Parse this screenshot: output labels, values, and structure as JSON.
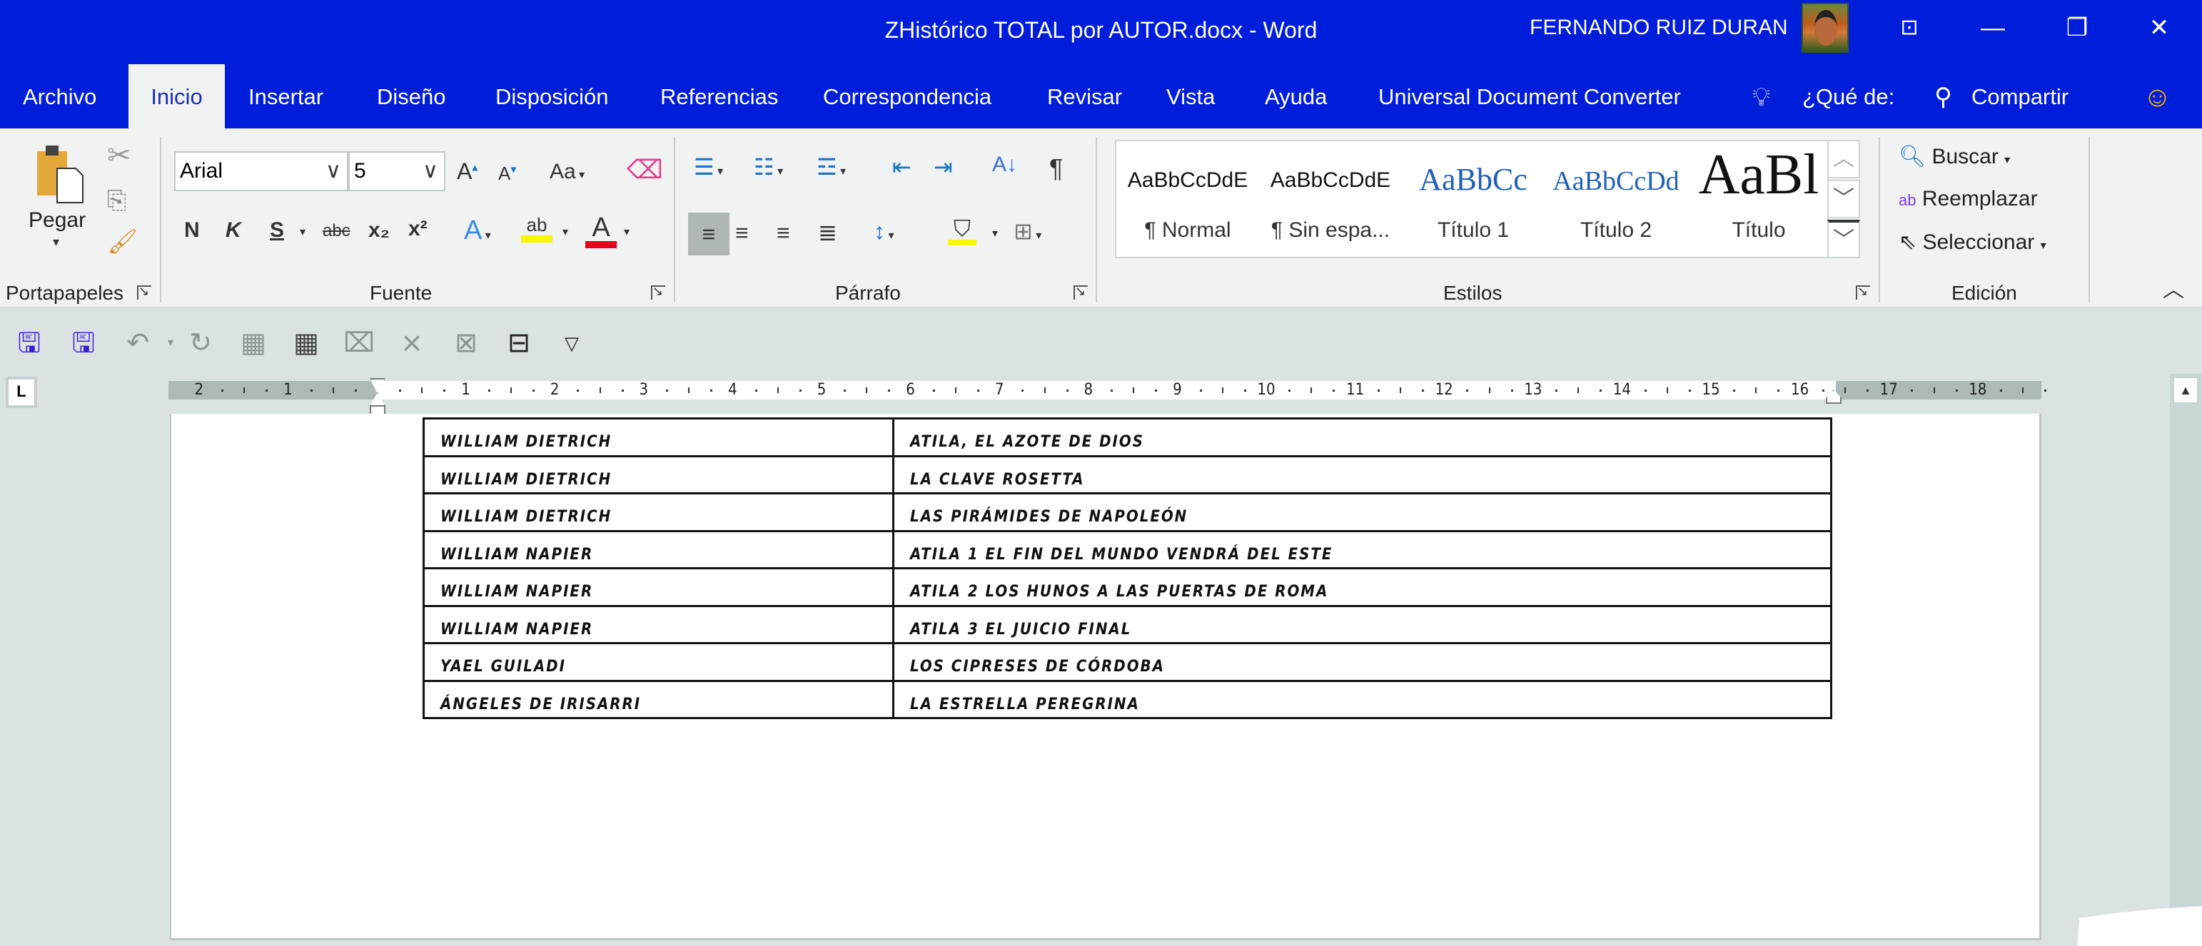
{
  "window": {
    "title": "ZHistórico TOTAL por AUTOR.docx  -  Word",
    "user_name": "FERNANDO RUIZ DURAN",
    "controls": {
      "ribbon_display": "⊡",
      "minimize": "—",
      "restore": "❐",
      "close": "✕"
    }
  },
  "tabs": [
    {
      "label": "Archivo",
      "active": false
    },
    {
      "label": "Inicio",
      "active": true
    },
    {
      "label": "Insertar",
      "active": false
    },
    {
      "label": "Diseño",
      "active": false
    },
    {
      "label": "Disposición",
      "active": false
    },
    {
      "label": "Referencias",
      "active": false
    },
    {
      "label": "Correspondencia",
      "active": false
    },
    {
      "label": "Revisar",
      "active": false
    },
    {
      "label": "Vista",
      "active": false
    },
    {
      "label": "Ayuda",
      "active": false
    },
    {
      "label": "Universal Document Converter",
      "active": false
    }
  ],
  "tell_me": {
    "placeholder": "¿Qué de:",
    "share": "Compartir"
  },
  "ribbon": {
    "clipboard": {
      "label": "Portapapeles",
      "paste": "Pegar"
    },
    "font": {
      "label": "Fuente",
      "font_name": "Arial",
      "font_size": "5",
      "grow": "A",
      "shrink": "A",
      "change_case": "Aa",
      "bold": "N",
      "italic": "K",
      "underline": "S",
      "strike": "abc",
      "subscript": "x₂",
      "superscript": "x²",
      "highlight_color": "#f7f700",
      "font_color": "#e3001b"
    },
    "paragraph": {
      "label": "Párrafo",
      "active_align": "left"
    },
    "styles": {
      "label": "Estilos",
      "items": [
        {
          "sample": "AaBbCcDdE",
          "name": "¶ Normal"
        },
        {
          "sample": "AaBbCcDdE",
          "name": "¶ Sin espa..."
        },
        {
          "sample": "AaBbCc",
          "name": "Título 1"
        },
        {
          "sample": "AaBbCcDd",
          "name": "Título 2"
        },
        {
          "sample": "AaBl",
          "name": "Título"
        }
      ]
    },
    "editing": {
      "label": "Edición",
      "find": "Buscar",
      "replace": "Reemplazar",
      "select": "Seleccionar"
    }
  },
  "ruler": {
    "left_numbers": [
      "2",
      "1"
    ],
    "numbers": [
      "1",
      "2",
      "3",
      "4",
      "5",
      "6",
      "7",
      "8",
      "9",
      "10",
      "11",
      "12",
      "13",
      "14",
      "15",
      "16",
      "17",
      "18"
    ]
  },
  "table": {
    "rows": [
      {
        "author": "William Dietrich",
        "title": "Atila, el azote de Dios"
      },
      {
        "author": "William Dietrich",
        "title": "La clave Rosetta"
      },
      {
        "author": "William Dietrich",
        "title": "Las pirámides de Napoleón"
      },
      {
        "author": "William Napier",
        "title": "Atila 1 El fin del mundo vendrá del este"
      },
      {
        "author": "William Napier",
        "title": "Atila 2 Los hunos a las puertas de Roma"
      },
      {
        "author": "William Napier",
        "title": "Atila 3 El juicio final"
      },
      {
        "author": "Yael Guiladi",
        "title": "Los cipreses de Córdoba"
      },
      {
        "author": "Ángeles de Irisarri",
        "title": "La estrella peregrina"
      }
    ]
  },
  "colors": {
    "accent": "#001ed9",
    "ribbon_bg": "#f1f3f3",
    "canvas_bg": "#dbe3e2"
  }
}
